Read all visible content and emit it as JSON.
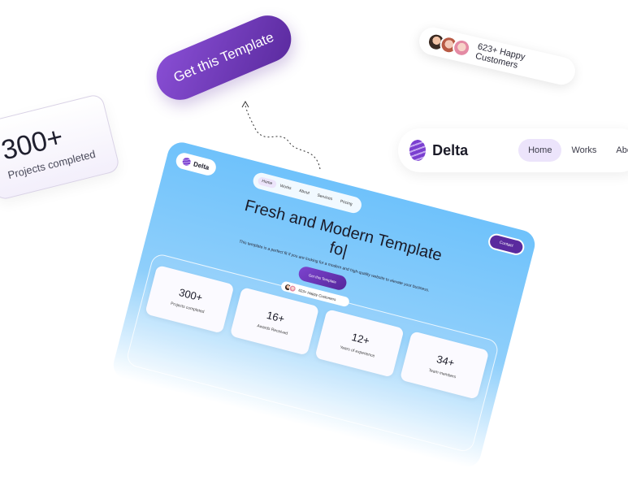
{
  "cta_button": {
    "label": "Get this Template"
  },
  "floating_stat": {
    "value": "300+",
    "label": "Projects completed"
  },
  "customers_pill": {
    "label": "623+ Happy Customers"
  },
  "floating_nav": {
    "brand": "Delta",
    "items": [
      {
        "label": "Home",
        "active": true
      },
      {
        "label": "Works",
        "active": false
      },
      {
        "label": "Abo",
        "active": false
      }
    ]
  },
  "mockup": {
    "brand": "Delta",
    "nav": [
      {
        "label": "Home",
        "active": true
      },
      {
        "label": "Works"
      },
      {
        "label": "About"
      },
      {
        "label": "Services"
      },
      {
        "label": "Pricing"
      }
    ],
    "contact_label": "Contact",
    "hero_title_line1": "Fresh and Modern Template",
    "hero_title_line2": "fo|",
    "hero_subtitle": "This template is a perfect fit if you are looking for a modern and high-quality website to elevate your business.",
    "cta_label": "Get this Template",
    "customers_label": "623+ Happy Customers",
    "stats": [
      {
        "value": "300+",
        "label": "Projects completed"
      },
      {
        "value": "16+",
        "label": "Awards Received"
      },
      {
        "value": "12+",
        "label": "Years of experience"
      },
      {
        "value": "34+",
        "label": "Team members"
      }
    ]
  },
  "colors": {
    "accent": "#6a33b8",
    "sky": "#6fc2fb",
    "pill_bg": "#ece4fb"
  }
}
